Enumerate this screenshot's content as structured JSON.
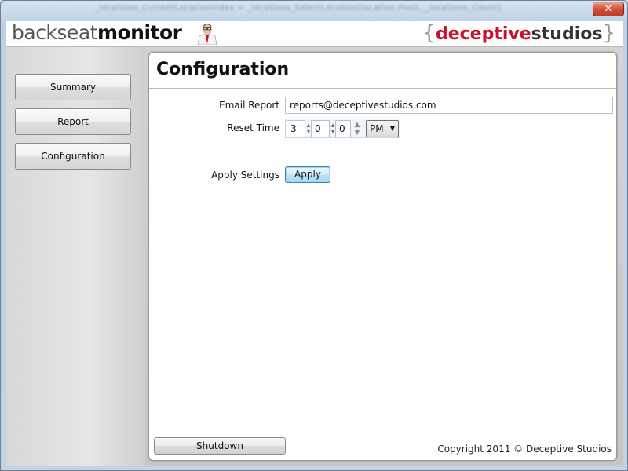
{
  "window": {
    "title": "_locations_CurrentLocationIndex = _locations_SelectLocation(location.Posit, _locations_Count)",
    "close_glyph": "✕"
  },
  "header": {
    "logo_light": "backseat",
    "logo_bold": "monitor",
    "brand_brace_open": "{",
    "brand_red": "deceptive",
    "brand_dark": "studios",
    "brand_brace_close": "}"
  },
  "sidebar": {
    "items": [
      {
        "label": "Summary"
      },
      {
        "label": "Report"
      },
      {
        "label": "Configuration"
      }
    ]
  },
  "main": {
    "title": "Configuration",
    "email_label": "Email Report",
    "email_value": "reports@deceptivestudios.com",
    "reset_label": "Reset Time",
    "time": {
      "hour": "3",
      "minute": "0",
      "second": "0",
      "ampm": "PM"
    },
    "apply_label": "Apply Settings",
    "apply_button": "Apply"
  },
  "footer": {
    "shutdown": "Shutdown",
    "copyright": "Copyright 2011 © Deceptive Studios"
  },
  "colors": {
    "brand_red": "#c8102e",
    "accent_blue": "#3c7fb1"
  }
}
